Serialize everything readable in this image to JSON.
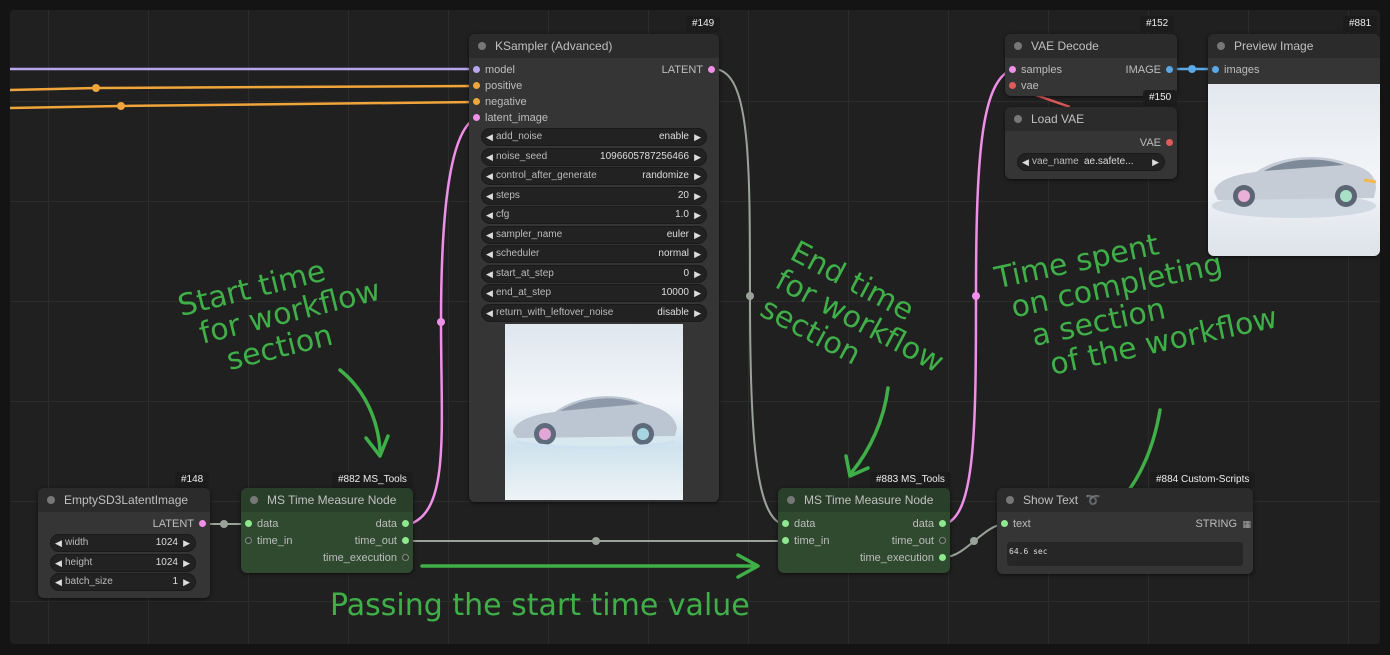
{
  "colors": {
    "model_wire": "#b9a6f0",
    "conditioning_wire": "#f0a53a",
    "latent_wire": "#f08fe8",
    "image_wire": "#5aa8e6",
    "time_wire": "#9aa39a",
    "vae_wire": "#e05a5a",
    "annotation": "#3faf48"
  },
  "nodes": {
    "ksampler": {
      "badge": "#149",
      "title": "KSampler (Advanced)",
      "inputs": [
        "model",
        "positive",
        "negative",
        "latent_image"
      ],
      "output": "LATENT",
      "widgets": [
        {
          "label": "add_noise",
          "value": "enable"
        },
        {
          "label": "noise_seed",
          "value": "1096605787256466"
        },
        {
          "label": "control_after_generate",
          "value": "randomize"
        },
        {
          "label": "steps",
          "value": "20"
        },
        {
          "label": "cfg",
          "value": "1.0"
        },
        {
          "label": "sampler_name",
          "value": "euler"
        },
        {
          "label": "scheduler",
          "value": "normal"
        },
        {
          "label": "start_at_step",
          "value": "0"
        },
        {
          "label": "end_at_step",
          "value": "10000"
        },
        {
          "label": "return_with_leftover_noise",
          "value": "disable"
        }
      ]
    },
    "vae_decode": {
      "badge": "#152",
      "title": "VAE Decode",
      "inputs": [
        "samples",
        "vae"
      ],
      "output": "IMAGE"
    },
    "load_vae": {
      "badge": "#150",
      "title": "Load VAE",
      "output": "VAE",
      "widget": {
        "label": "vae_name",
        "value": "ae.safete..."
      }
    },
    "preview": {
      "badge": "#881",
      "title": "Preview Image",
      "input": "images"
    },
    "empty_latent": {
      "badge": "#148",
      "title": "EmptySD3LatentImage",
      "output": "LATENT",
      "widgets": [
        {
          "label": "width",
          "value": "1024"
        },
        {
          "label": "height",
          "value": "1024"
        },
        {
          "label": "batch_size",
          "value": "1"
        }
      ]
    },
    "timer1": {
      "badge": "#882 MS_Tools",
      "title": "MS Time Measure Node",
      "inputs": [
        "data",
        "time_in"
      ],
      "outputs": [
        "data",
        "time_out",
        "time_execution"
      ]
    },
    "timer2": {
      "badge": "#883 MS_Tools",
      "title": "MS Time Measure Node",
      "inputs": [
        "data",
        "time_in"
      ],
      "outputs": [
        "data",
        "time_out",
        "time_execution"
      ]
    },
    "show_text": {
      "badge": "#884 Custom-Scripts",
      "title": "Show Text",
      "title_icon": "snake-icon",
      "input": "text",
      "output": "STRING",
      "output_icon": "grid-icon",
      "text_value": "64.6 sec"
    }
  },
  "annotations": {
    "start": [
      "Start time",
      "for workflow",
      "section"
    ],
    "end": [
      "End time",
      "for workflow",
      "section"
    ],
    "spent": [
      "Time spent",
      "on completing",
      "a section",
      "of the workflow"
    ],
    "passing": "Passing the start time value"
  }
}
